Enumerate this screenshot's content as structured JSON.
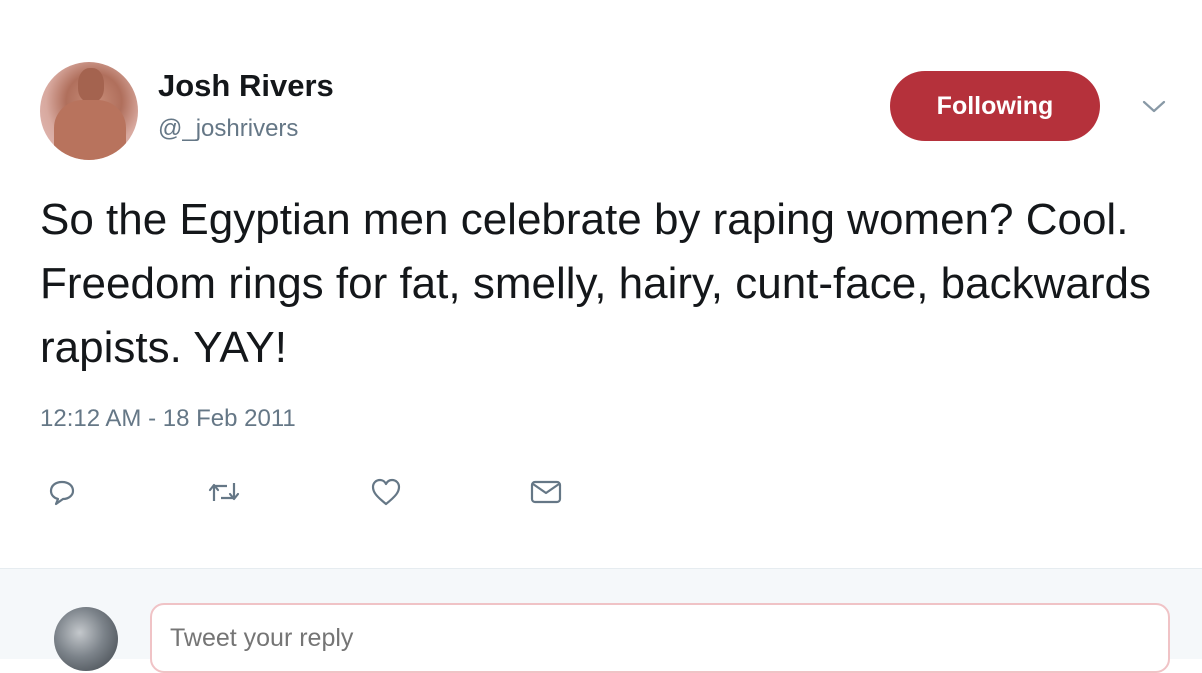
{
  "tweet": {
    "author_name": "Josh Rivers",
    "author_handle": "@_joshrivers",
    "follow_label": "Following",
    "text": "So the Egyptian men celebrate by raping women? Cool. Freedom rings for fat, smelly, hairy, cunt-face, backwards rapists. YAY!",
    "timestamp": "12:12 AM - 18 Feb 2011",
    "actions": [
      {
        "icon": "reply-icon"
      },
      {
        "icon": "retweet-icon"
      },
      {
        "icon": "like-icon"
      },
      {
        "icon": "direct-message-icon"
      }
    ]
  },
  "reply": {
    "placeholder": "Tweet your reply"
  },
  "colors": {
    "follow_button": "#b5313b",
    "secondary_text": "#657786",
    "primary_text": "#14171a",
    "reply_bar_bg": "#f5f8fa"
  }
}
